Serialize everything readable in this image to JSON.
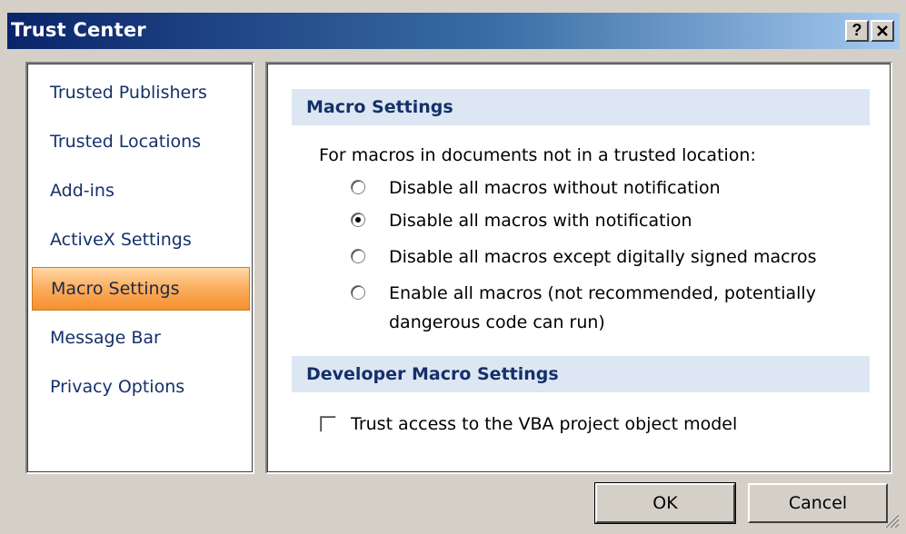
{
  "window": {
    "title": "Trust Center",
    "help_label": "?",
    "close_label": "✕"
  },
  "sidebar": {
    "items": [
      {
        "label": "Trusted Publishers"
      },
      {
        "label": "Trusted Locations"
      },
      {
        "label": "Add-ins"
      },
      {
        "label": "ActiveX Settings"
      },
      {
        "label": "Macro Settings",
        "selected": true
      },
      {
        "label": "Message Bar"
      },
      {
        "label": "Privacy Options"
      }
    ]
  },
  "macro_settings": {
    "header": "Macro Settings",
    "intro": "For macros in documents not in a trusted location:",
    "options": [
      {
        "label": "Disable all macros without notification",
        "selected": false
      },
      {
        "label": "Disable all macros with notification",
        "selected": true
      },
      {
        "label": "Disable all macros except digitally signed macros",
        "selected": false
      },
      {
        "label": "Enable all macros (not recommended, potentially",
        "label_line2": "dangerous code can run)",
        "selected": false
      }
    ]
  },
  "developer_settings": {
    "header": "Developer Macro Settings",
    "trust_vba_label": "Trust access to the VBA project object model",
    "trust_vba_checked": false
  },
  "buttons": {
    "ok": "OK",
    "cancel": "Cancel"
  },
  "colors": {
    "title_gradient_start": "#0a246a",
    "title_gradient_end": "#a6caf0",
    "selected_nav": "#f68f2e",
    "section_header_bg": "#dde7f3",
    "nav_text": "#15306a"
  }
}
